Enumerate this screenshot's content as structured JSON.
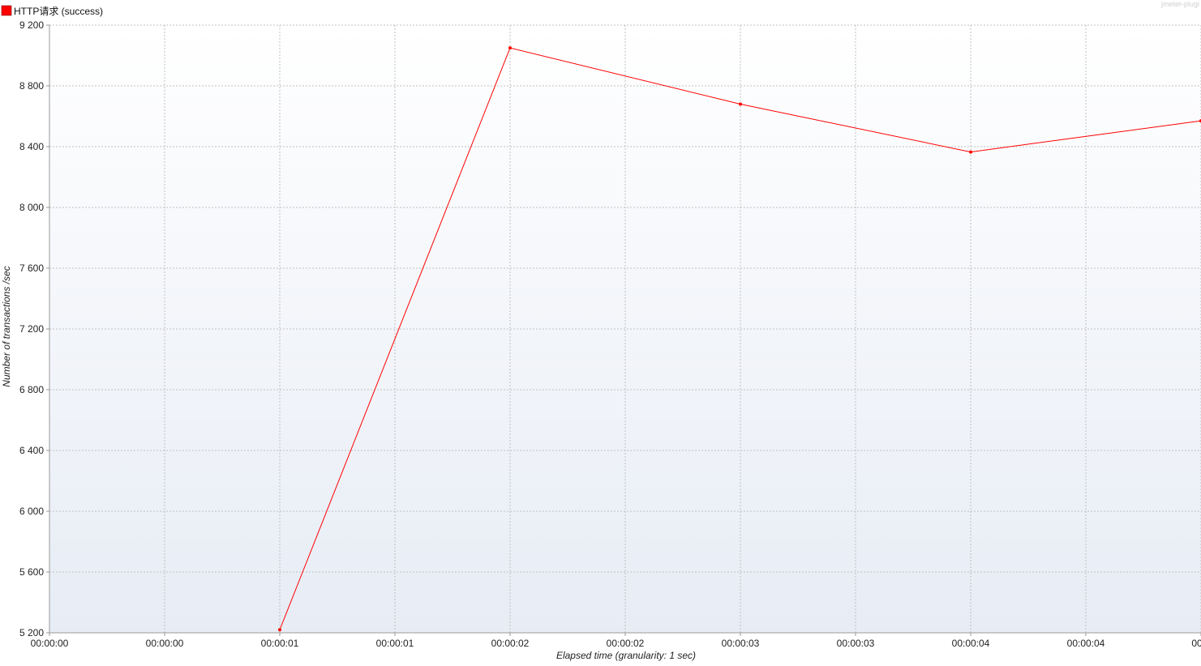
{
  "chart_data": {
    "type": "line",
    "legend_position": "top-left",
    "watermark": "jmeter-plugi",
    "xlabel": "Elapsed time (granularity: 1 sec)",
    "ylabel": "Number of transactions /sec",
    "x_tick_labels": [
      "00:00:00",
      "00:00:00",
      "00:00:01",
      "00:00:01",
      "00:00:02",
      "00:00:02",
      "00:00:03",
      "00:00:03",
      "00:00:04",
      "00:00:04",
      "00:0"
    ],
    "x_range_sec": [
      0,
      5
    ],
    "y_ticks": [
      5200,
      5600,
      6000,
      6400,
      6800,
      7200,
      7600,
      8000,
      8400,
      8800,
      9200
    ],
    "y_tick_labels": [
      "5 200",
      "5 600",
      "6 000",
      "6 400",
      "6 800",
      "7 200",
      "7 600",
      "8 000",
      "8 400",
      "8 800",
      "9 200"
    ],
    "ylim": [
      5200,
      9200
    ],
    "grid": true,
    "series": [
      {
        "name": "HTTP请求 (success)",
        "color": "#ff0000",
        "points": [
          {
            "x_sec": 1,
            "y": 5220
          },
          {
            "x_sec": 2,
            "y": 9050
          },
          {
            "x_sec": 3,
            "y": 8680
          },
          {
            "x_sec": 4,
            "y": 8365
          },
          {
            "x_sec": 5,
            "y": 8570
          }
        ]
      }
    ]
  },
  "colors": {
    "plot_bg_top": "#ffffff",
    "plot_bg_bottom": "#e7ecf5",
    "grid": "#c0c0c0",
    "axis": "#9a9a9a"
  }
}
